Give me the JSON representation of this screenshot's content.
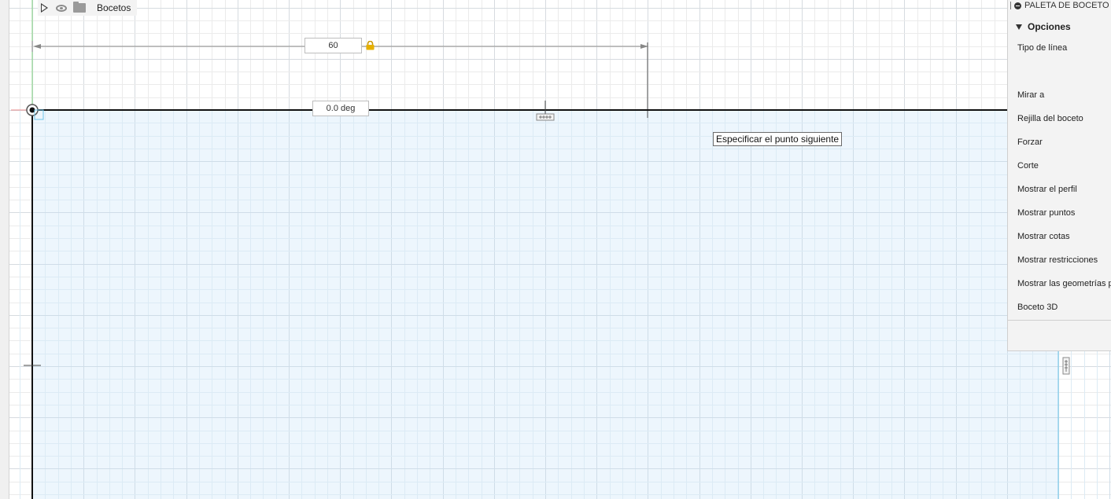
{
  "browser": {
    "node_label": "Bocetos"
  },
  "sketch": {
    "length_dimension": "60",
    "angle_dimension": "0.0 deg",
    "prompt_tooltip": "Especificar el punto siguiente",
    "length_locked": true
  },
  "palette": {
    "title": "PALETA DE BOCETO",
    "section": "Opciones",
    "items": [
      "Tipo de línea",
      "Mirar a",
      "Rejilla del boceto",
      "Forzar",
      "Corte",
      "Mostrar el perfil",
      "Mostrar puntos",
      "Mostrar cotas",
      "Mostrar restricciones",
      "Mostrar las geometrías p",
      "Boceto 3D"
    ]
  },
  "colors": {
    "grid_minor": "#ebebeb",
    "grid_major": "#d6dbe0",
    "profile_fill": "#eaf5fd",
    "sketch_line": "#111111",
    "lock_yellow": "#e6b000",
    "axis_green": "#7ed27e",
    "axis_red": "#e88888",
    "profile_edge": "#6ec6ea"
  },
  "icons": [
    "expand-triangle-icon",
    "visibility-eye-icon",
    "folder-icon",
    "lock-icon",
    "origin-point-icon",
    "horizontal-constraint-icon",
    "vertical-constraint-icon",
    "collapse-palette-icon",
    "section-caret-icon"
  ]
}
